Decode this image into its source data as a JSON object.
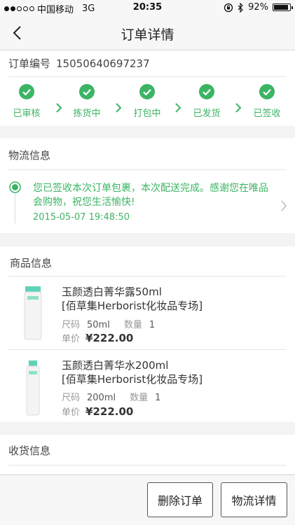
{
  "status_bar": {
    "carrier": "中国移动",
    "network": "3G",
    "time": "20:35",
    "battery_percent": "92%",
    "battery_level": 0.92,
    "signal_bars_filled": 2,
    "icons": [
      "lock-rotation-icon",
      "bluetooth-icon",
      "battery-icon"
    ]
  },
  "nav": {
    "title": "订单详情",
    "back_icon": "chevron-left-icon"
  },
  "order": {
    "label": "订单编号",
    "number": "15050640697237",
    "steps": [
      {
        "label": "已审核"
      },
      {
        "label": "拣货中"
      },
      {
        "label": "打包中"
      },
      {
        "label": "已发货"
      },
      {
        "label": "已签收"
      }
    ]
  },
  "logistics": {
    "title": "物流信息",
    "message": "您已签收本次订单包裹，本次配送完成。感谢您在唯品会购物，祝您生活愉快!",
    "time": "2015-05-07 19:48:50"
  },
  "goods": {
    "title": "商品信息",
    "size_label": "尺码",
    "qty_label": "数量",
    "price_label": "单价",
    "products": [
      {
        "name_line1": "玉颜透白菁华露50ml",
        "name_line2": "[佰草集Herborist化妆品专场]",
        "size": "50ml",
        "qty": "1",
        "price": "¥222.00"
      },
      {
        "name_line1": "玉颜透白菁华水200ml",
        "name_line2": "[佰草集Herborist化妆品专场]",
        "size": "200ml",
        "qty": "1",
        "price": "¥222.00"
      }
    ]
  },
  "receiving": {
    "title": "收货信息"
  },
  "actions": {
    "delete": "删除订单",
    "logistics_detail": "物流详情"
  },
  "colors": {
    "accent_green": "#3cb464",
    "background": "#f3f3f3"
  }
}
